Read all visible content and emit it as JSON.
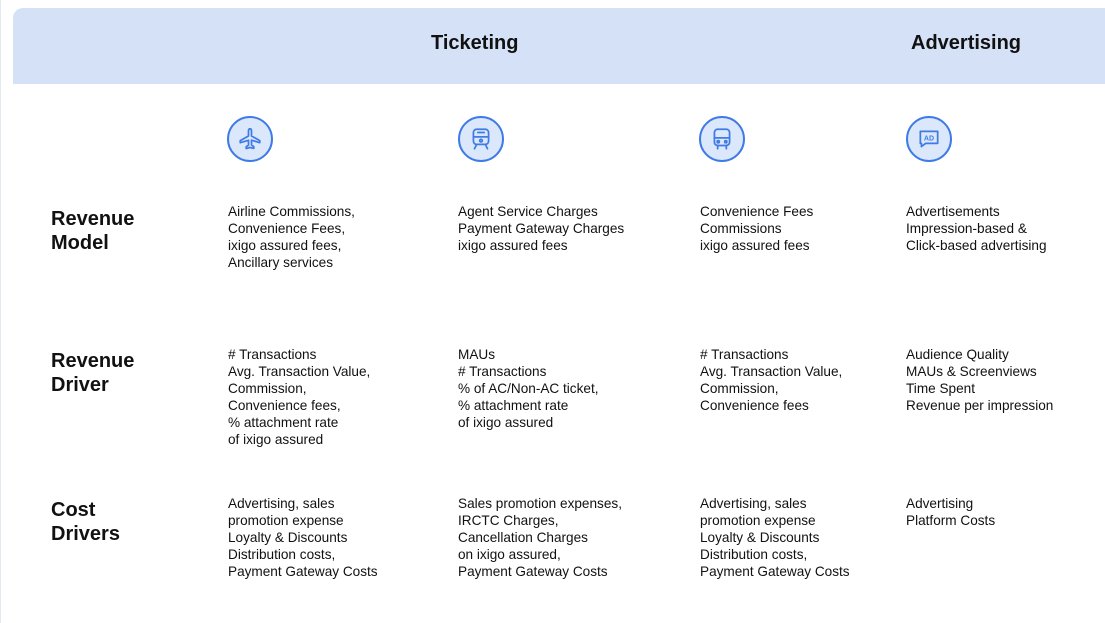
{
  "headers": {
    "ticketing": "Ticketing",
    "advertising": "Advertising"
  },
  "icons": [
    "airplane-icon",
    "train-icon",
    "bus-icon",
    "ad-icon"
  ],
  "colors": {
    "header_bg": "#d5e1f6",
    "icon_stroke": "#3f7be6",
    "icon_fill": "#dbe7fb"
  },
  "rows": {
    "revenue_model": {
      "label": [
        "Revenue",
        "Model"
      ],
      "cells": [
        [
          "Airline Commissions,",
          "Convenience Fees,",
          "ixigo assured fees,",
          "Ancillary services"
        ],
        [
          "Agent Service Charges",
          "Payment Gateway Charges",
          "ixigo assured fees"
        ],
        [
          "Convenience Fees",
          "Commissions",
          "ixigo assured fees"
        ],
        [
          "Advertisements",
          "Impression-based &",
          "Click-based advertising"
        ]
      ]
    },
    "revenue_driver": {
      "label": [
        "Revenue",
        "Driver"
      ],
      "cells": [
        [
          "# Transactions",
          "Avg. Transaction Value,",
          "Commission,",
          "Convenience fees,",
          "% attachment rate",
          "of ixigo assured"
        ],
        [
          "MAUs",
          "# Transactions",
          "% of AC/Non-AC ticket,",
          "% attachment rate",
          "of ixigo assured"
        ],
        [
          "# Transactions",
          "Avg. Transaction Value,",
          "Commission,",
          "Convenience fees"
        ],
        [
          "Audience Quality",
          "MAUs & Screenviews",
          "Time Spent",
          "Revenue per impression"
        ]
      ]
    },
    "cost_drivers": {
      "label": [
        "Cost",
        "Drivers"
      ],
      "cells": [
        [
          "Advertising, sales",
          "promotion expense",
          "Loyalty & Discounts",
          "Distribution costs,",
          "Payment Gateway Costs"
        ],
        [
          "Sales promotion expenses,",
          "IRCTC Charges,",
          "Cancellation Charges",
          "on ixigo assured,",
          "Payment Gateway Costs"
        ],
        [
          "Advertising, sales",
          "promotion expense",
          "Loyalty & Discounts",
          "Distribution costs,",
          "Payment Gateway Costs"
        ],
        [
          "Advertising",
          "Platform Costs"
        ]
      ]
    }
  }
}
